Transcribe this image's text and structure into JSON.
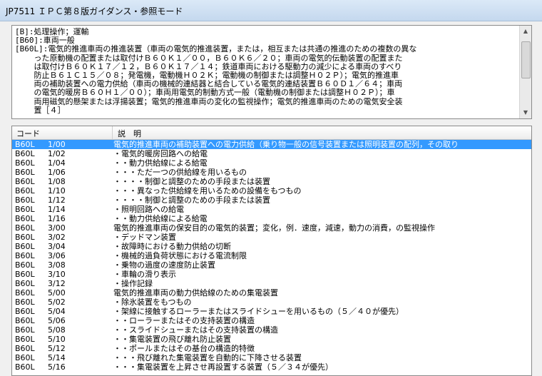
{
  "window": {
    "title": "JP7511 ＩＰＣ第８版ガイダンス・参照モード"
  },
  "description": {
    "lines": [
      "[B]:処理操作；運輸",
      "[B60]:車両一般",
      "[B60L]:電気的推進車両の推進装置（車両の電気的推進装置，または，相互または共通の推進のための複数の異な",
      "    った原動機の配置または取付けＢ６０Ｋ１／００，Ｂ６０Ｋ６／２０；車両の電気的伝動装置の配置また",
      "    は取付けＢ６０Ｋ１７／１２，Ｂ６０Ｋ１７／１４；鉄道車両における駆動力の減少による車両のすべり",
      "    防止Ｂ６１Ｃ１５／０８；発電機，電動機Ｈ０２Ｋ；電動機の制御または調整Ｈ０２Ｐ）；電気的推進車",
      "    両の補助装置への電力供給（車両の機械的連結器と結合している電気的連結装置Ｂ６０Ｄ１／６４；車両",
      "    の電気的暖房Ｂ６０Ｈ１／００）；車両用電気的制動方式一般（電動機の制御または調整Ｈ０２Ｐ）；車",
      "    両用磁気的懸架または浮揚装置；電気的推進車両の変化の監視操作；電気的推進車両のための電気安全装",
      "    置［４］"
    ]
  },
  "list": {
    "headers": {
      "code": "コード",
      "description": "説　明"
    },
    "selected_index": 0,
    "rows": [
      {
        "code": "B60L",
        "sub": "1/00",
        "text": "電気的推進車両の補助装置への電力供給（乗り物一般の信号装置または照明装置の配列，その取り"
      },
      {
        "code": "B60L",
        "sub": "1/02",
        "text": "・電気的暖房回路への給電"
      },
      {
        "code": "B60L",
        "sub": "1/04",
        "text": "・・動力供給線による給電"
      },
      {
        "code": "B60L",
        "sub": "1/06",
        "text": "・・・ただ一つの供給線を用いるもの"
      },
      {
        "code": "B60L",
        "sub": "1/08",
        "text": "・・・・制御と調整のための手段または装置"
      },
      {
        "code": "B60L",
        "sub": "1/10",
        "text": "・・・異なった供給線を用いるための設備をもつもの"
      },
      {
        "code": "B60L",
        "sub": "1/12",
        "text": "・・・・制御と調整のための手段または装置"
      },
      {
        "code": "B60L",
        "sub": "1/14",
        "text": "・照明回路への給電"
      },
      {
        "code": "B60L",
        "sub": "1/16",
        "text": "・・動力供給線による給電"
      },
      {
        "code": "B60L",
        "sub": "3/00",
        "text": "電気的推進車両の保安目的の電気的装置；変化，例．速度，減速，動力の消費，の監視操作"
      },
      {
        "code": "B60L",
        "sub": "3/02",
        "text": "・デッドマン装置"
      },
      {
        "code": "B60L",
        "sub": "3/04",
        "text": "・故障時における動力供給の切断"
      },
      {
        "code": "B60L",
        "sub": "3/06",
        "text": "・機械的過負荷状態における電流制限"
      },
      {
        "code": "B60L",
        "sub": "3/08",
        "text": "・乗物の過度の速度防止装置"
      },
      {
        "code": "B60L",
        "sub": "3/10",
        "text": "・車輪の滑り表示"
      },
      {
        "code": "B60L",
        "sub": "3/12",
        "text": "・操作記録"
      },
      {
        "code": "B60L",
        "sub": "5/00",
        "text": "電気的推進車両の動力供給線のための集電装置"
      },
      {
        "code": "B60L",
        "sub": "5/02",
        "text": "・除氷装置をもつもの"
      },
      {
        "code": "B60L",
        "sub": "5/04",
        "text": "・架線に接触するローラーまたはスライドシューを用いるもの（５／４０が優先）"
      },
      {
        "code": "B60L",
        "sub": "5/06",
        "text": "・・ローラーまたはその支持装置の構造"
      },
      {
        "code": "B60L",
        "sub": "5/08",
        "text": "・・スライドシューまたはその支持装置の構造"
      },
      {
        "code": "B60L",
        "sub": "5/10",
        "text": "・・集電装置の飛び離れ防止装置"
      },
      {
        "code": "B60L",
        "sub": "5/12",
        "text": "・・ポールまたはその基台の構造的特徴"
      },
      {
        "code": "B60L",
        "sub": "5/14",
        "text": "・・・飛び離れた集電装置を自動的に下降させる装置"
      },
      {
        "code": "B60L",
        "sub": "5/16",
        "text": "・・・集電装置を上昇させ再設置する装置（５／３４が優先）"
      }
    ]
  }
}
